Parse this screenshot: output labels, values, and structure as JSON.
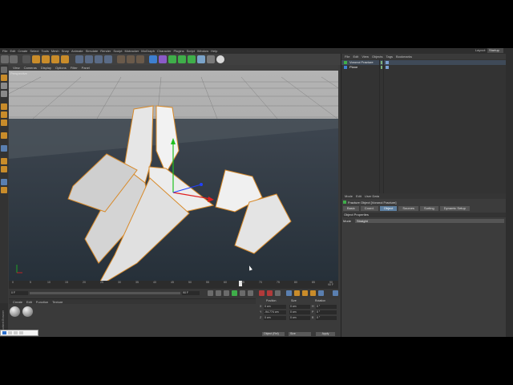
{
  "app": {
    "menus": [
      "File",
      "Edit",
      "Create",
      "Select",
      "Tools",
      "Mesh",
      "Snap",
      "Animate",
      "Simulate",
      "Render",
      "Sculpt",
      "Motracker",
      "MoGraph",
      "Character",
      "Plugins",
      "Script",
      "Window",
      "Help"
    ],
    "layout_label": "Layout:",
    "layout_value": "Startup"
  },
  "viewport": {
    "menu": [
      "View",
      "Cameras",
      "Display",
      "Options",
      "Filter",
      "Panel"
    ],
    "label": "Perspective"
  },
  "timeline": {
    "ticks": [
      "0",
      "5",
      "10",
      "15",
      "20",
      "25",
      "30",
      "35",
      "40",
      "45",
      "50",
      "55",
      "60",
      "65",
      "70",
      "75",
      "80",
      "85",
      "90"
    ],
    "end_frame": "90 F",
    "start_field": "0 F",
    "end_field_a": "90 F",
    "end_field_b": "90 F"
  },
  "materials": {
    "menu": [
      "Create",
      "Edit",
      "Function",
      "Texture"
    ],
    "count": 2
  },
  "coords": {
    "headers": [
      "Position",
      "Size",
      "Rotation"
    ],
    "rows": [
      {
        "axis": "X",
        "pos": "0 cm",
        "size": "0 cm",
        "rot_axis": "H",
        "rot": "0 °"
      },
      {
        "axis": "Y",
        "pos": "-94.774 cm",
        "size": "0 cm",
        "rot_axis": "P",
        "rot": "0 °"
      },
      {
        "axis": "Z",
        "pos": "0 cm",
        "size": "0 cm",
        "rot_axis": "B",
        "rot": "0 °"
      }
    ],
    "mode": "Object (Rel)",
    "size_mode": "Size",
    "apply": "Apply"
  },
  "object_manager": {
    "menu": [
      "File",
      "Edit",
      "View",
      "Objects",
      "Tags",
      "Bookmarks"
    ],
    "objects": [
      {
        "name": "Voronoi Fracture",
        "selected": true
      },
      {
        "name": "Plane",
        "selected": false
      }
    ]
  },
  "attributes": {
    "menu": [
      "Mode",
      "Edit",
      "User Data"
    ],
    "title": "Fracture Object [Voronoi Fracture]",
    "tabs": [
      "Basic",
      "Coord.",
      "Object",
      "Sources",
      "Sorting",
      "Dynamic Setup"
    ],
    "active_tab": "Object",
    "section": "Object Properties",
    "mode_label": "Mode",
    "mode_value": "Straight"
  },
  "sidebar_tab": "Content Browser",
  "colors": {
    "accent": "#5d7fa0",
    "selection": "#ff9a1a",
    "axis_x": "#e02020",
    "axis_y": "#20c020",
    "axis_z": "#2040ff"
  }
}
